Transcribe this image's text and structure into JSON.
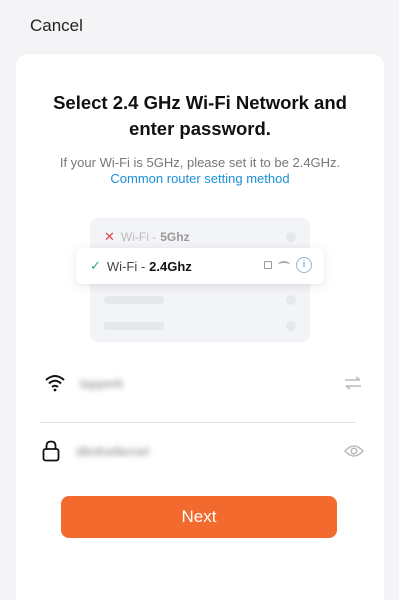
{
  "header": {
    "cancel_label": "Cancel"
  },
  "title": "Select 2.4 GHz Wi-Fi Network and enter password.",
  "subtitle": "If your Wi-Fi is 5GHz, please set it to be 2.4GHz.",
  "router_link": "Common router setting method",
  "illustration": {
    "row_5g_prefix": "Wi-Fi -",
    "row_5g_band": "5Ghz",
    "row_24g_prefix": "Wi-Fi -",
    "row_24g_band": "2.4Ghz",
    "status_colors": {
      "bad": "#e04545",
      "good": "#2fae6b"
    }
  },
  "wifi_field": {
    "value": "tapperk",
    "icon": "wifi-icon",
    "switch_icon": "swap-icon"
  },
  "password_field": {
    "value": "dlinthellernel",
    "icon": "lock-icon",
    "toggle_icon": "eye-icon"
  },
  "next_button": {
    "label": "Next",
    "color": "#f26a2e"
  },
  "colors": {
    "link": "#1a8fd6",
    "accent": "#f26a2e"
  }
}
